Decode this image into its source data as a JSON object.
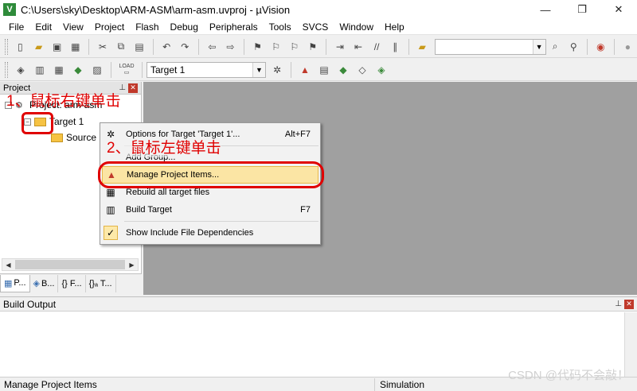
{
  "window": {
    "title": "C:\\Users\\sky\\Desktop\\ARM-ASM\\arm-asm.uvproj - µVision",
    "app_icon": "V"
  },
  "menu": [
    "File",
    "Edit",
    "View",
    "Project",
    "Flash",
    "Debug",
    "Peripherals",
    "Tools",
    "SVCS",
    "Window",
    "Help"
  ],
  "toolbar2": {
    "target_select": "Target 1",
    "load_label": "LOAD"
  },
  "project_panel": {
    "title": "Project",
    "root": "Project: arm-asm",
    "target": "Target 1",
    "group": "Source",
    "tabs": [
      "P...",
      "B...",
      "{} F...",
      "{}ₐ T..."
    ]
  },
  "context_menu": {
    "items": [
      {
        "label": "Options for Target 'Target 1'...",
        "shortcut": "Alt+F7"
      },
      {
        "label": "Add Group...",
        "shortcut": ""
      },
      {
        "label": "Manage Project Items...",
        "shortcut": ""
      },
      {
        "label": "Rebuild all target files",
        "shortcut": ""
      },
      {
        "label": "Build Target",
        "shortcut": "F7"
      },
      {
        "label": "Show Include File Dependencies",
        "shortcut": ""
      }
    ]
  },
  "annotations": {
    "step1": "1、鼠标右键单击",
    "step2": "2、鼠标左键单击"
  },
  "build_output": {
    "title": "Build Output"
  },
  "status": {
    "left": "Manage Project Items",
    "mode": "Simulation"
  },
  "watermark": "CSDN @代码不会敲！",
  "colors": {
    "annotation": "#e00000",
    "workarea": "#a0a0a0",
    "highlight": "#fbe5a4"
  }
}
